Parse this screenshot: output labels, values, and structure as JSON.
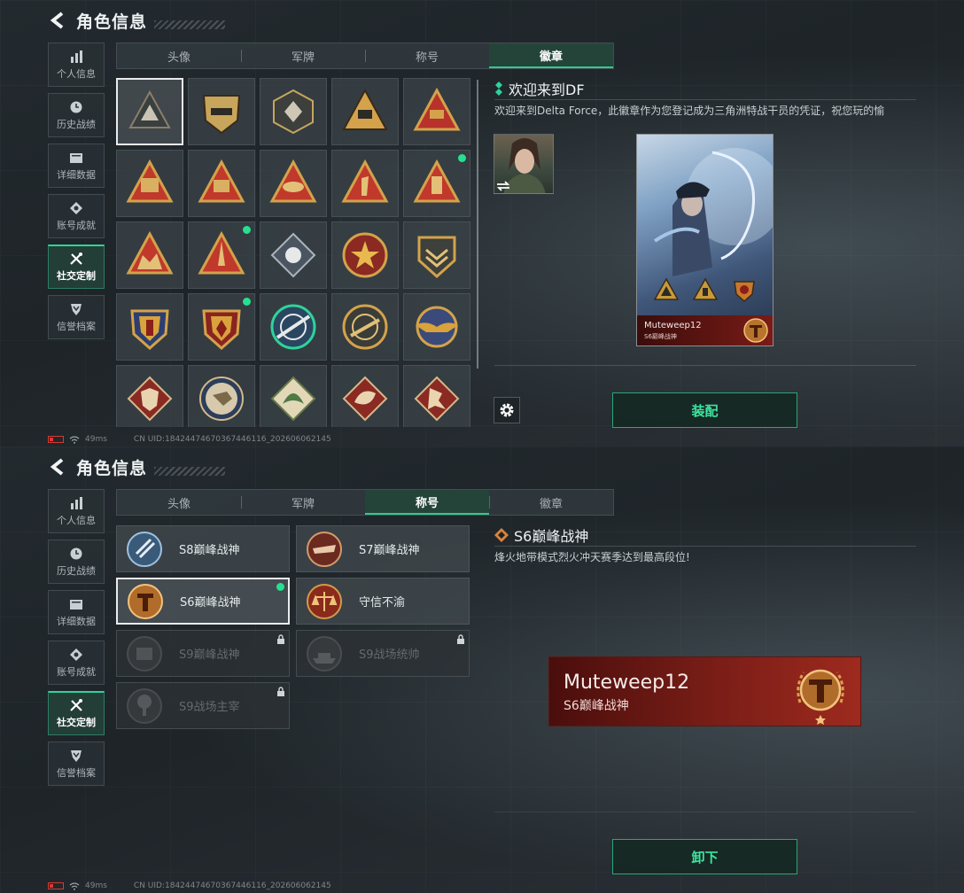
{
  "colors": {
    "accent": "#2fd39a",
    "button_text": "#3be6a0",
    "new_dot": "#27e08f",
    "banner_red": "#7b1e17"
  },
  "header": {
    "title": "角色信息",
    "back_icon": "back-arrow-icon"
  },
  "sidebar": {
    "items": [
      {
        "label": "个人信息",
        "icon": "bar-chart-icon"
      },
      {
        "label": "历史战绩",
        "icon": "clock-icon"
      },
      {
        "label": "详细数据",
        "icon": "folder-icon"
      },
      {
        "label": "账号成就",
        "icon": "medal-icon"
      },
      {
        "label": "社交定制",
        "icon": "tools-icon"
      },
      {
        "label": "信誉档案",
        "icon": "shield-icon"
      }
    ],
    "active_label": "社交定制"
  },
  "tabs": [
    {
      "label": "头像"
    },
    {
      "label": "军牌"
    },
    {
      "label": "称号"
    },
    {
      "label": "徽章"
    }
  ],
  "screen1": {
    "active_tab": "徽章",
    "badges": [
      {
        "name": "delta-force-badge",
        "selected": true,
        "new": false
      },
      {
        "name": "helicopter-badge",
        "selected": false,
        "new": false
      },
      {
        "name": "hexagon-badge",
        "selected": false,
        "new": false
      },
      {
        "name": "s5-badge",
        "selected": false,
        "new": false
      },
      {
        "name": "s6-badge",
        "selected": false,
        "new": false
      },
      {
        "name": "s7-badge",
        "selected": false,
        "new": false
      },
      {
        "name": "s8-badge",
        "selected": false,
        "new": false
      },
      {
        "name": "hat-badge",
        "selected": false,
        "new": false
      },
      {
        "name": "number-one-badge",
        "selected": false,
        "new": false
      },
      {
        "name": "flash-drive-badge",
        "selected": false,
        "new": true
      },
      {
        "name": "soldiers-badge",
        "selected": false,
        "new": false
      },
      {
        "name": "rocket-badge",
        "selected": false,
        "new": true
      },
      {
        "name": "rose-badge",
        "selected": false,
        "new": false
      },
      {
        "name": "star-shield-badge",
        "selected": false,
        "new": false
      },
      {
        "name": "chevron-shield-badge",
        "selected": false,
        "new": false
      },
      {
        "name": "crest-badge",
        "selected": false,
        "new": false
      },
      {
        "name": "crest-red-badge",
        "selected": false,
        "new": true
      },
      {
        "name": "sniper-crosshair-badge",
        "selected": false,
        "new": false
      },
      {
        "name": "rifle-crosshair-badge",
        "selected": false,
        "new": false
      },
      {
        "name": "winged-star-badge",
        "selected": false,
        "new": false
      },
      {
        "name": "wolf-badge",
        "selected": false,
        "new": false
      },
      {
        "name": "eagle-badge",
        "selected": false,
        "new": false
      },
      {
        "name": "dragon-green-badge",
        "selected": false,
        "new": false
      },
      {
        "name": "dragon-red-badge",
        "selected": false,
        "new": false
      },
      {
        "name": "runner-badge",
        "selected": false,
        "new": false
      }
    ],
    "detail": {
      "title": "欢迎来到DF",
      "description": "欢迎来到Delta Force，此徽章作为您登记成为三角洲特战干员的凭证，祝您玩的愉"
    },
    "card": {
      "player_name": "Muteweep12",
      "title_name": "S6巅峰战神"
    },
    "settings_icon": "gear-icon",
    "action_label": "装配"
  },
  "screen2": {
    "active_tab": "称号",
    "titles": [
      {
        "label": "S8巅峰战神",
        "emblem": "s8-emblem-icon",
        "selected": false,
        "locked": false,
        "new": false
      },
      {
        "label": "S7巅峰战神",
        "emblem": "s7-emblem-icon",
        "selected": false,
        "locked": false,
        "new": false
      },
      {
        "label": "S6巅峰战神",
        "emblem": "s6-emblem-icon",
        "selected": true,
        "locked": false,
        "new": true
      },
      {
        "label": "守信不渝",
        "emblem": "scales-emblem-icon",
        "selected": false,
        "locked": false,
        "new": false
      },
      {
        "label": "S9巅峰战神",
        "emblem": "s9-emblem-icon",
        "selected": false,
        "locked": true,
        "new": false
      },
      {
        "label": "S9战场统帅",
        "emblem": "ship-emblem-icon",
        "selected": false,
        "locked": true,
        "new": false
      },
      {
        "label": "S9战场主宰",
        "emblem": "tree-emblem-icon",
        "selected": false,
        "locked": true,
        "new": false
      }
    ],
    "detail": {
      "title": "S6巅峰战神",
      "description": "烽火地带模式烈火冲天赛季达到最高段位!"
    },
    "banner": {
      "player_name": "Muteweep12",
      "title_name": "S6巅峰战神"
    },
    "action_label": "卸下"
  },
  "status": {
    "ping": "49ms",
    "uid": "CN UID:18424474670367446116_202606062145"
  }
}
